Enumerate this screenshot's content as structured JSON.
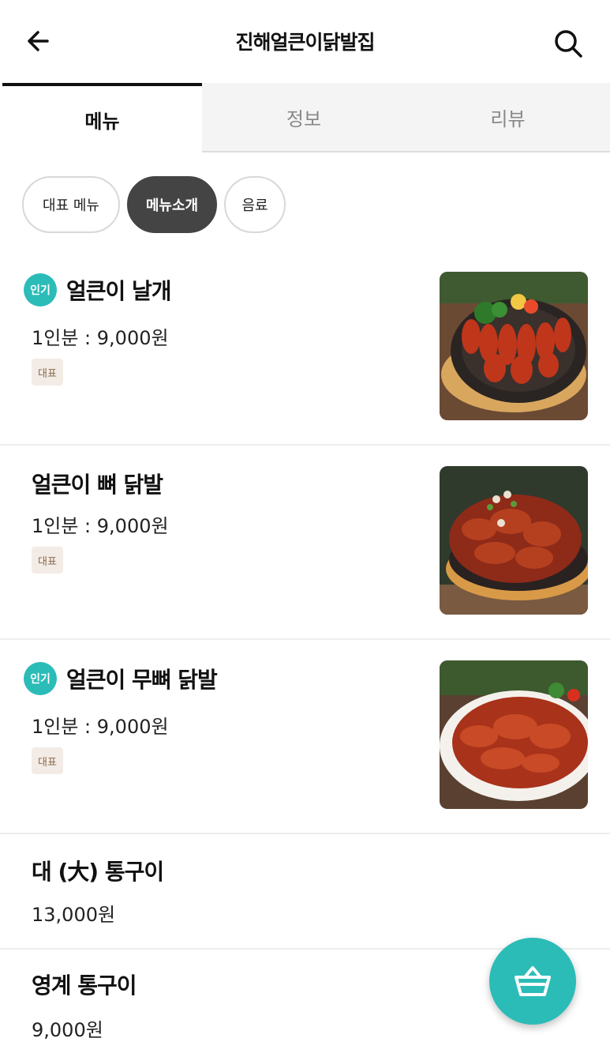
{
  "header": {
    "title": "진해얼큰이닭발집",
    "back_icon": "arrow-left-icon",
    "search_icon": "search-icon"
  },
  "tabs": [
    {
      "label": "메뉴",
      "active": true
    },
    {
      "label": "정보",
      "active": false
    },
    {
      "label": "리뷰",
      "active": false
    }
  ],
  "chips": [
    {
      "label": "대표 메뉴",
      "active": false
    },
    {
      "label": "메뉴소개",
      "active": true
    },
    {
      "label": "음료",
      "active": false
    }
  ],
  "menu": [
    {
      "name": "얼큰이 날개",
      "price": "1인분 : 9,000원",
      "hot": "인기",
      "badge": "대표",
      "photo": "chicken-wings"
    },
    {
      "name": "얼큰이 뼈 닭발",
      "price": "1인분 : 9,000원",
      "badge": "대표",
      "photo": "bone-feet"
    },
    {
      "name": "얼큰이 무뼈 닭발",
      "price": "1인분 : 9,000원",
      "hot": "인기",
      "badge": "대표",
      "photo": "boneless-feet"
    },
    {
      "name": "대 (大) 통구이",
      "price": "13,000원"
    },
    {
      "name": "영계 통구이",
      "price": "9,000원"
    }
  ],
  "cart": {
    "icon": "basket-icon"
  },
  "colors": {
    "accent": "#2bbcb8",
    "chip_active": "#444444",
    "badge_bg": "#f3ece6",
    "badge_text": "#8a6a4e"
  }
}
